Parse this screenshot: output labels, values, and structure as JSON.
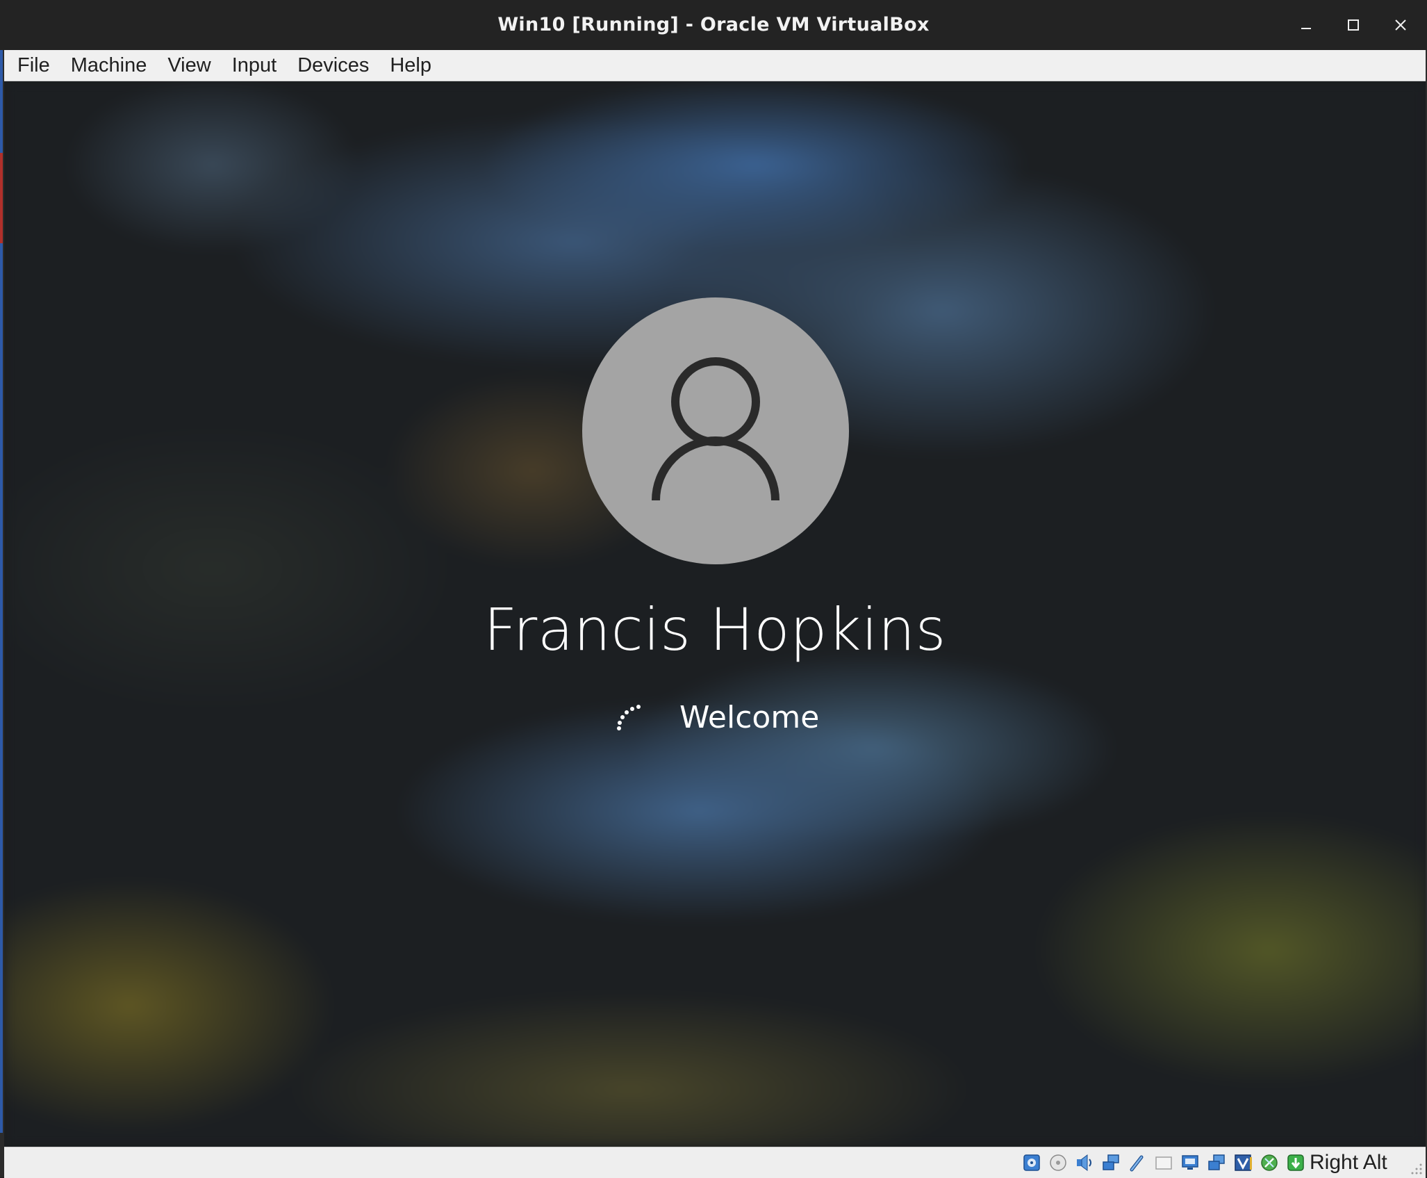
{
  "window": {
    "title": "Win10 [Running] - Oracle VM VirtualBox",
    "controls": [
      "minimize-icon",
      "maximize-icon",
      "close-icon"
    ]
  },
  "menubar": {
    "items": [
      {
        "label": "File"
      },
      {
        "label": "Machine"
      },
      {
        "label": "View"
      },
      {
        "label": "Input"
      },
      {
        "label": "Devices"
      },
      {
        "label": "Help"
      }
    ]
  },
  "vm_screen": {
    "user_name": "Francis Hopkins",
    "status_text": "Welcome",
    "avatar_icon": "user-icon",
    "spinner_icon": "loading-spinner-icon"
  },
  "statusbar": {
    "icons": [
      "hard-disk-icon",
      "optical-drive-icon",
      "audio-icon",
      "network-icon",
      "usb-icon",
      "shared-folders-icon",
      "display-icon",
      "video-capture-icon",
      "virtualization-icon",
      "mouse-integration-icon",
      "keyboard-capture-icon"
    ],
    "host_key": "Right Alt"
  },
  "colors": {
    "titlebar_bg": "#232323",
    "menubar_bg": "#f0f0f0",
    "avatar_bg": "#a4a4a4",
    "statusbar_bg": "#eeeeee"
  }
}
